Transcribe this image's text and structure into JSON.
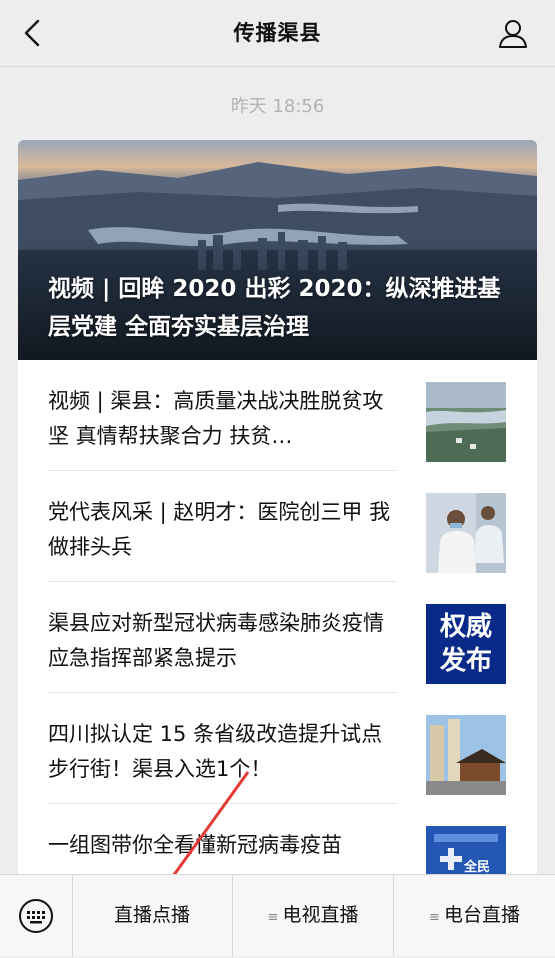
{
  "header": {
    "title": "传播渠县",
    "back_icon": "chevron-left-icon",
    "profile_icon": "person-icon"
  },
  "timestamp": "昨天 18:56",
  "hero": {
    "title": "视频 | 回眸 2020 出彩 2020：纵深推进基层党建 全面夯实基层治理"
  },
  "articles": [
    {
      "title": "视频 | 渠县：高质量决战决胜脱贫攻坚 真情帮扶聚合力 扶贫…"
    },
    {
      "title": "党代表风采 | 赵明才：医院创三甲 我做排头兵"
    },
    {
      "title": "渠县应对新型冠状病毒感染肺炎疫情应急指挥部紧急提示",
      "thumb_text": [
        "权威",
        "发布"
      ]
    },
    {
      "title": "四川拟认定 15 条省级改造提升试点步行街！渠县入选1个！"
    },
    {
      "title": "一组图带你全看懂新冠病毒疫苗",
      "thumb_text": [
        "全民"
      ]
    }
  ],
  "bottom_menu": {
    "keyboard_icon": "keyboard-icon",
    "items": [
      {
        "label": "直播点播"
      },
      {
        "label": "电视直播"
      },
      {
        "label": "电台直播"
      }
    ]
  },
  "colors": {
    "background": "#ededed",
    "arrow": "#e53935",
    "badge_blue": "#0a2a8a"
  }
}
